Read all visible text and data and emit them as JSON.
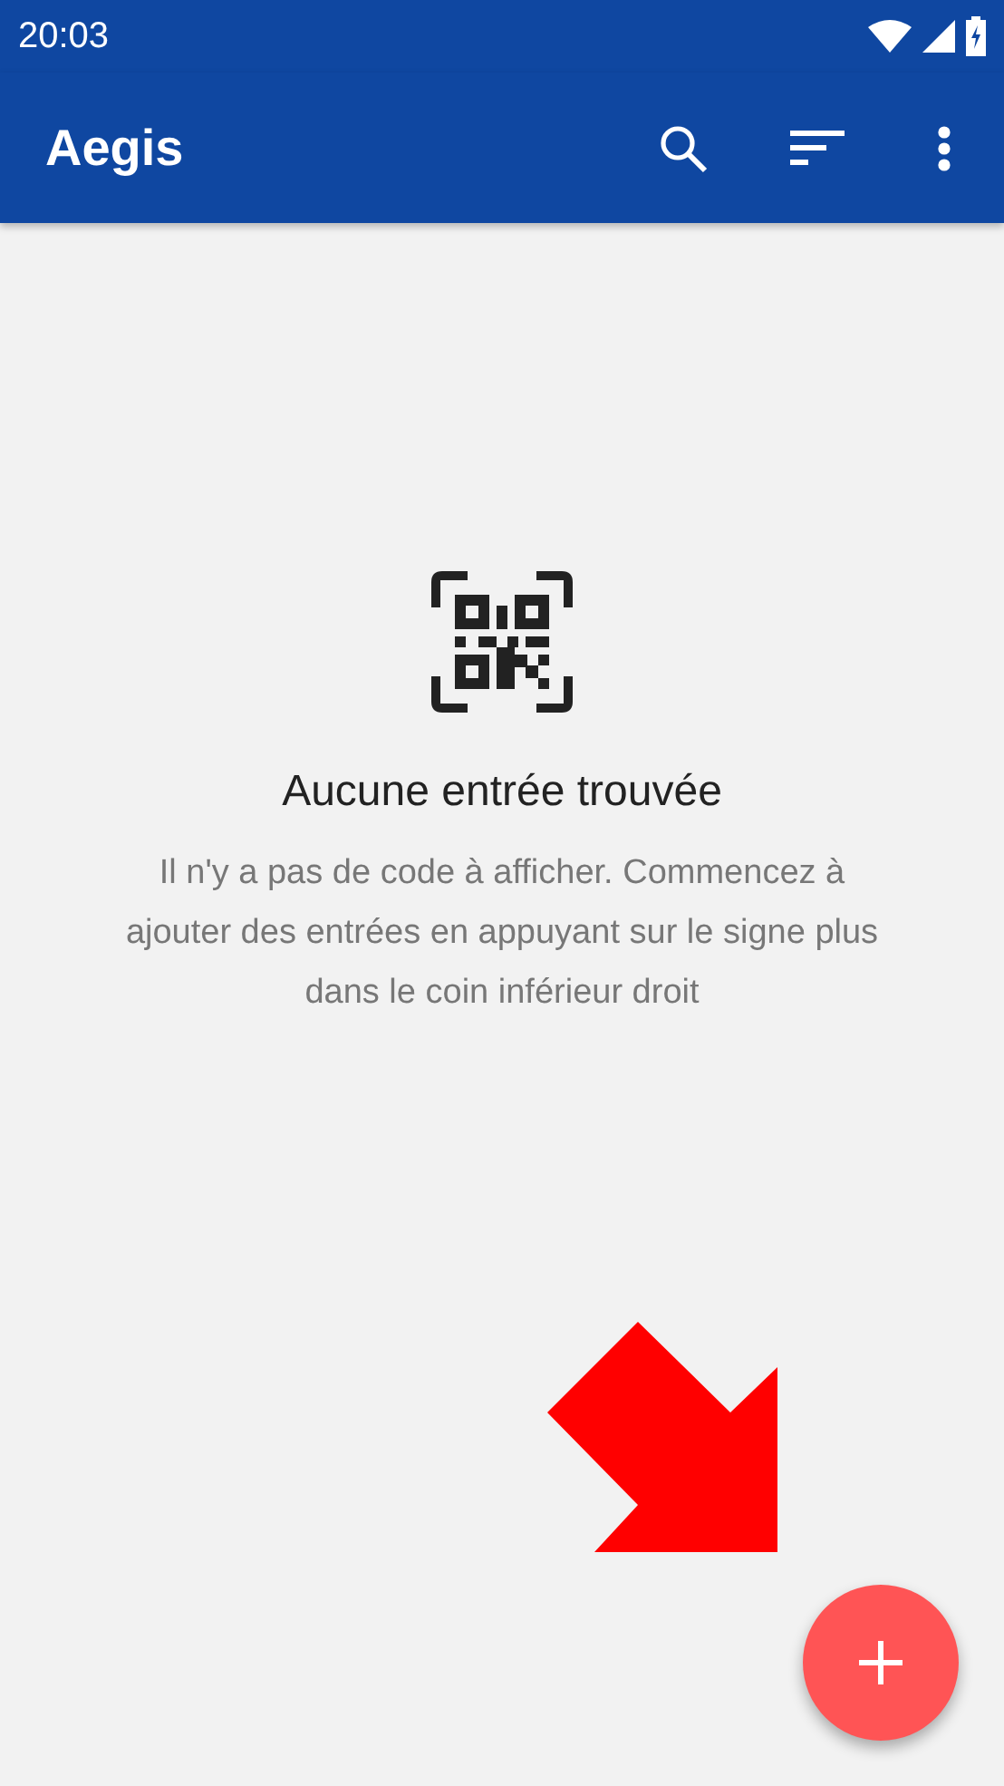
{
  "status_bar": {
    "time": "20:03"
  },
  "toolbar": {
    "title": "Aegis"
  },
  "empty_state": {
    "title": "Aucune entrée trouvée",
    "message": "Il n'y a pas de code à afficher. Commencez à ajouter des entrées en appuyant sur le signe plus dans le coin inférieur droit"
  }
}
